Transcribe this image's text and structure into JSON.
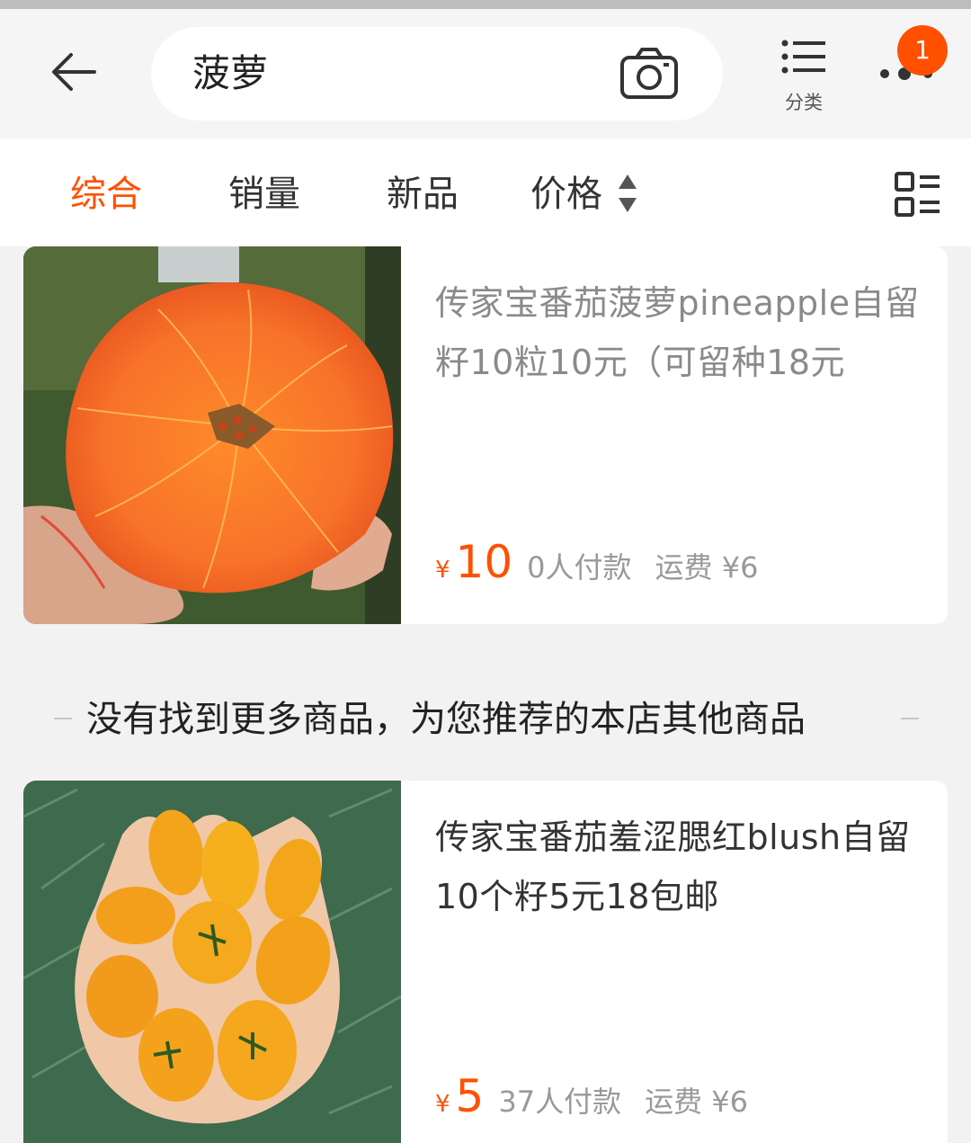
{
  "search": {
    "query": "菠萝",
    "category_label": "分类",
    "badge_count": "1"
  },
  "sort_tabs": [
    "综合",
    "销量",
    "新品",
    "价格"
  ],
  "products": [
    {
      "title": "传家宝番茄菠萝pineapple自留籽10粒10元（可留种18元",
      "yen": "¥",
      "price": "10",
      "sales": "0人付款",
      "shipping": "运费 ¥6"
    },
    {
      "title": "传家宝番茄羞涩腮红blush自留10个籽5元18包邮",
      "yen": "¥",
      "price": "5",
      "sales": "37人付款",
      "shipping": "运费 ¥6"
    }
  ],
  "recommend_divider": "没有找到更多商品，为您推荐的本店其他商品",
  "colors": {
    "accent": "#ff5000",
    "background": "#f2f2f2"
  },
  "icons": [
    "back-arrow-icon",
    "camera-icon",
    "category-list-icon",
    "more-dots-icon",
    "sort-arrows-icon",
    "view-toggle-icon"
  ]
}
